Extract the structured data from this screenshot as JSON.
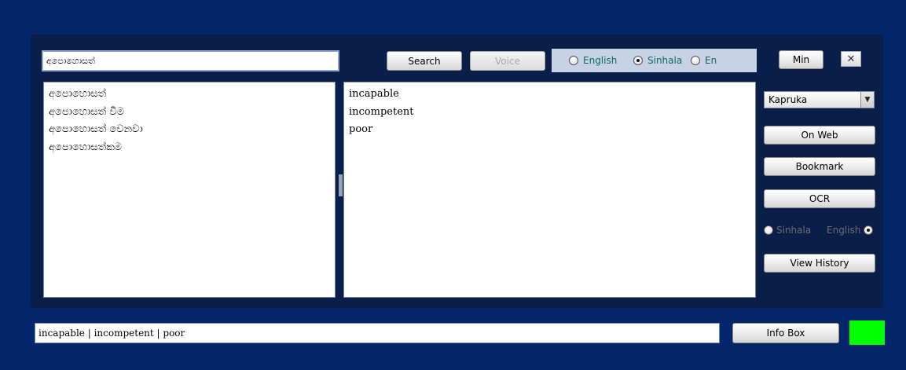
{
  "search": {
    "value": "අපොහොසත්"
  },
  "toolbar": {
    "search_label": "Search",
    "voice_label": "Voice",
    "min_label": "Min",
    "close_symbol": "✕"
  },
  "language_options": [
    {
      "label": "English",
      "selected": false
    },
    {
      "label": "Sinhala",
      "selected": true
    },
    {
      "label": "En",
      "selected": false
    }
  ],
  "word_list": [
    "අපොහොසත්",
    "අපොහොසත් වීම",
    "අපොහොසත් වෙනවා",
    "අපොහොසත්කම"
  ],
  "meanings": [
    "incapable",
    "incompetent",
    "poor"
  ],
  "sidebar": {
    "dictionary_select": "Kapruka",
    "on_web_label": "On Web",
    "bookmark_label": "Bookmark",
    "ocr_label": "OCR",
    "ocr_lang_sinhala": "Sinhala",
    "ocr_lang_english": "English",
    "view_history_label": "View History"
  },
  "status": {
    "text": "incapable | incompetent | poor",
    "info_box_label": "Info Box",
    "indicator_color": "#00ff00"
  },
  "colors": {
    "background": "#03266b",
    "panel": "#0a1e4a",
    "radio_text": "#0b6b6b"
  }
}
